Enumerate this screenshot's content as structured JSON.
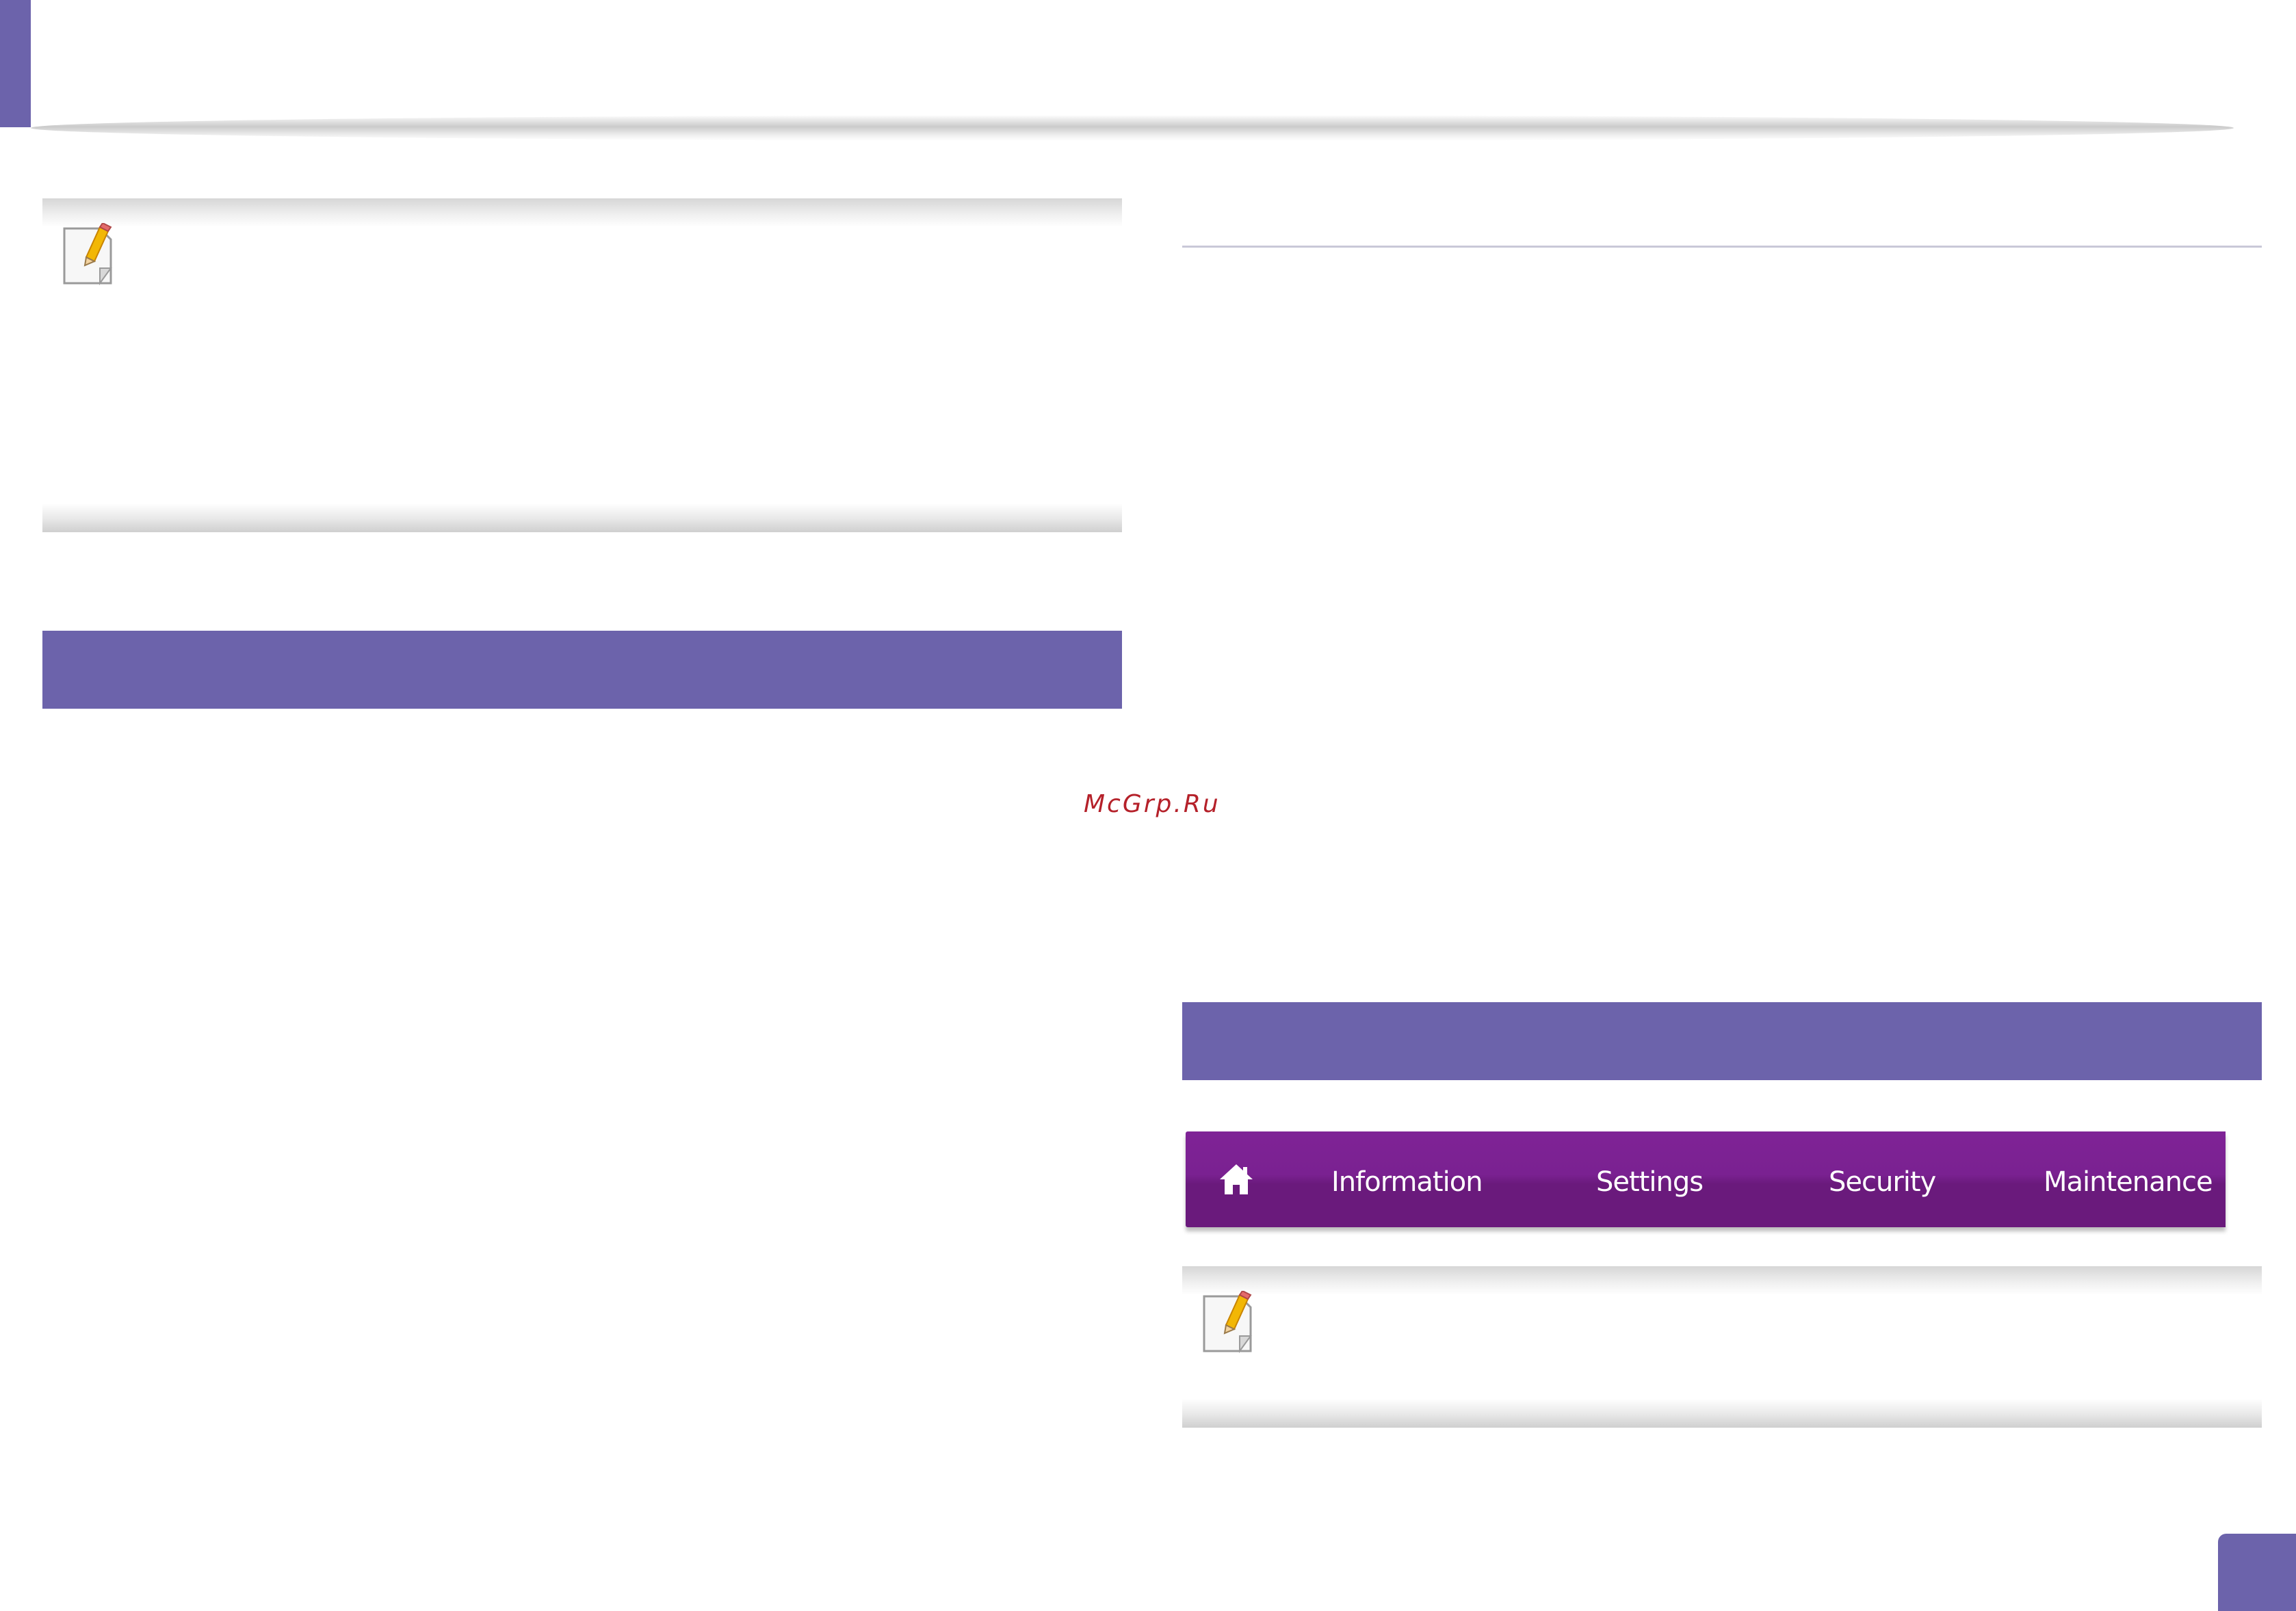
{
  "watermark": {
    "text": "McGrp.Ru"
  },
  "nav_menu": {
    "items": [
      {
        "label": "Information"
      },
      {
        "label": "Settings"
      },
      {
        "label": "Security"
      },
      {
        "label": "Maintenance"
      }
    ]
  },
  "icons": {
    "note": "note-pencil-icon",
    "home": "home-icon"
  },
  "colors": {
    "accent": "#6c63ab",
    "nav_background": "#7a2191",
    "watermark": "#b5212a"
  }
}
